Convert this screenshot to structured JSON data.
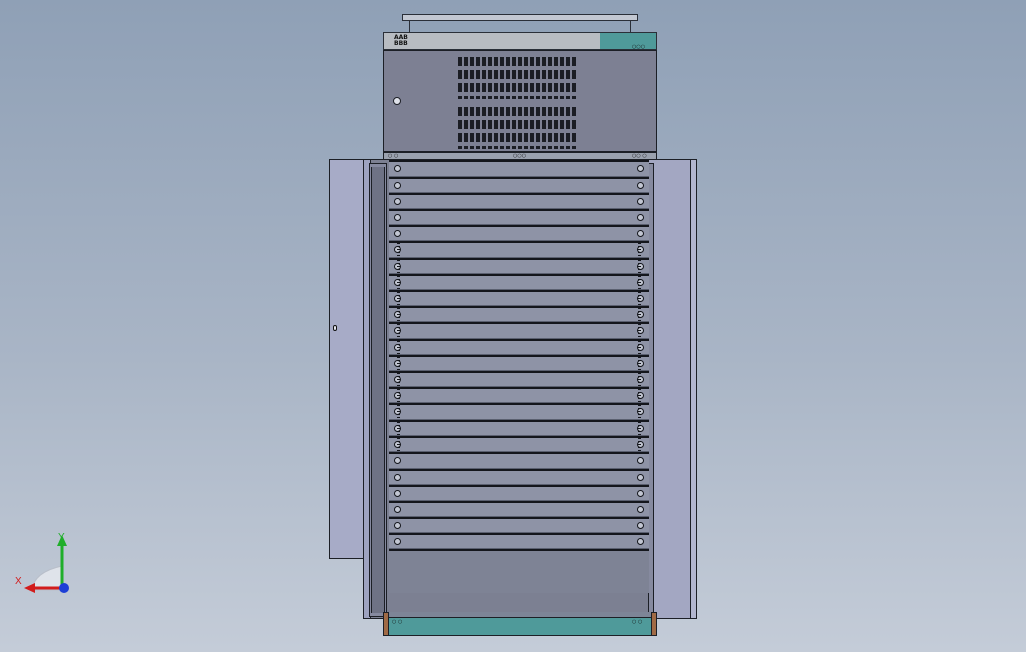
{
  "viewport": {
    "background": "#8fa0b6"
  },
  "cabinet": {
    "lid_badge": "AAB\nBBB",
    "lid_holes": "○○○",
    "fan_base_labels": [
      "○ ○",
      "○○○",
      "○○ ○"
    ],
    "plinth_labels": [
      "○ ○",
      "○ ○"
    ],
    "colors": {
      "body": "#7c8092",
      "door": "#a7abc7",
      "accent": "#4f9a9a",
      "plinth_edge": "#a06a45"
    },
    "rack_units": [
      {
        "h": 17,
        "stripes": false
      },
      {
        "h": 16,
        "stripes": false
      },
      {
        "h": 16,
        "stripes": false
      },
      {
        "h": 16,
        "stripes": false
      },
      {
        "h": 16,
        "stripes": false
      },
      {
        "h": 17,
        "stripes": true
      },
      {
        "h": 16,
        "stripes": true
      },
      {
        "h": 16,
        "stripes": true
      },
      {
        "h": 16,
        "stripes": true
      },
      {
        "h": 16,
        "stripes": true
      },
      {
        "h": 17,
        "stripes": true
      },
      {
        "h": 16,
        "stripes": true
      },
      {
        "h": 16,
        "stripes": true
      },
      {
        "h": 16,
        "stripes": true
      },
      {
        "h": 16,
        "stripes": true
      },
      {
        "h": 17,
        "stripes": true
      },
      {
        "h": 16,
        "stripes": true
      },
      {
        "h": 16,
        "stripes": true
      },
      {
        "h": 17,
        "stripes": false
      },
      {
        "h": 16,
        "stripes": false
      },
      {
        "h": 16,
        "stripes": false
      },
      {
        "h": 16,
        "stripes": false
      },
      {
        "h": 16,
        "stripes": false
      },
      {
        "h": 16,
        "stripes": false
      },
      {
        "h": 44,
        "stripes": false,
        "blank": true
      }
    ]
  },
  "triad": {
    "x_label": "X",
    "y_label": "Y",
    "colors": {
      "x": "#d21c1c",
      "y": "#1fae2a",
      "z": "#1d3fd6"
    }
  }
}
